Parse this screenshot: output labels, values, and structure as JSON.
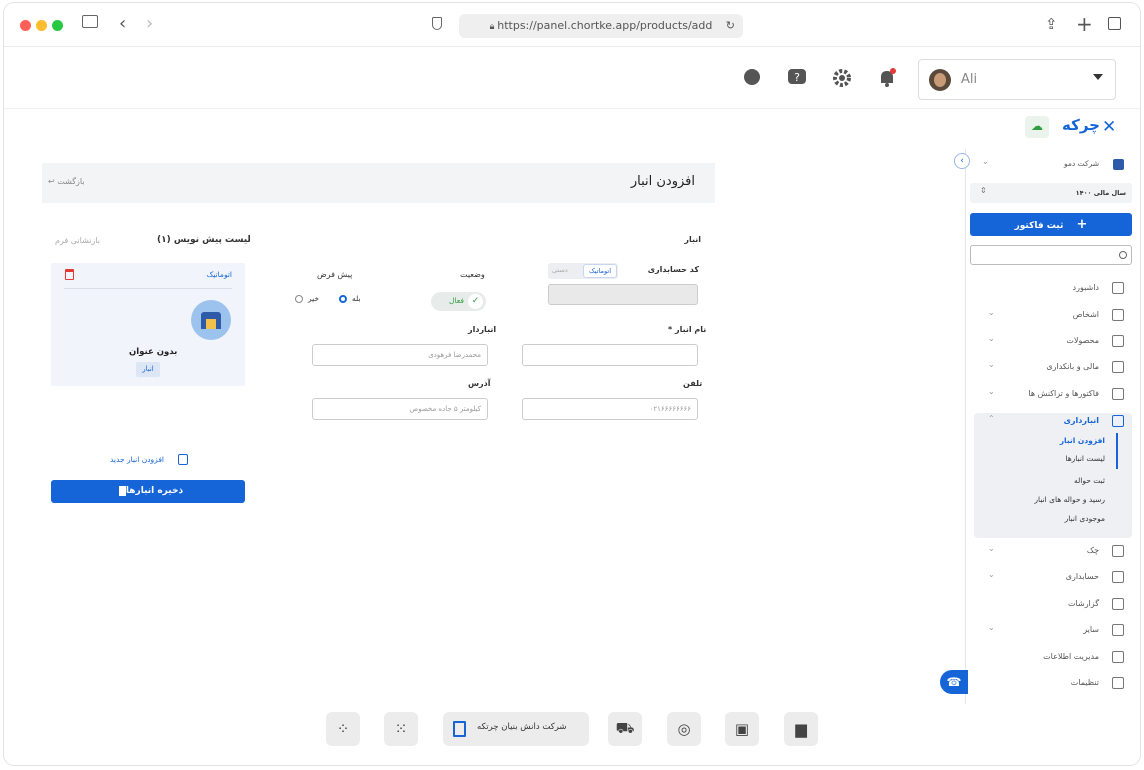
{
  "browser": {
    "url": "https://panel.chortke.app/products/add"
  },
  "header": {
    "user_name": "Ali"
  },
  "brand": {
    "name": "چرکه"
  },
  "sidebar": {
    "company": "شرکت دمو",
    "fiscal_year": "سال مالی ۱۴۰۰",
    "register_invoice": "ثبت فاکتور",
    "search_placeholder": "",
    "items": [
      {
        "label": "داشبورد",
        "icon": "dashboard-icon"
      },
      {
        "label": "اشخاص",
        "icon": "people-icon"
      },
      {
        "label": "محصولات",
        "icon": "box-icon"
      },
      {
        "label": "مالی و بانکداری",
        "icon": "bank-icon"
      },
      {
        "label": "فاکتورها و تراکنش ها",
        "icon": "transactions-icon"
      },
      {
        "label": "انبارداری",
        "icon": "warehouse-icon"
      },
      {
        "label": "چک",
        "icon": "check-icon"
      },
      {
        "label": "حسابداری",
        "icon": "accounting-icon"
      },
      {
        "label": "گزارشات",
        "icon": "reports-icon"
      },
      {
        "label": "سایر",
        "icon": "other-icon"
      },
      {
        "label": "مدیریت اطلاعات",
        "icon": "data-icon"
      },
      {
        "label": "تنظیمات",
        "icon": "settings-icon"
      }
    ],
    "warehouse_sub": [
      "افزودن انبار",
      "لیست انبارها",
      "ثبت حواله",
      "رسید و حواله های انبار",
      "موجودی انبار"
    ]
  },
  "page": {
    "title": "افزودن انبار",
    "back": "بازگشت",
    "section": "انبار",
    "accounting_code_label": "کد حسابداری",
    "code_auto": "اتوماتیک",
    "code_manual": "دستی",
    "status_label": "وضعیت",
    "status_value": "فعال",
    "default_label": "پیش فرض",
    "default_yes": "بله",
    "default_no": "خیر",
    "name_label": "نام انبار *",
    "keeper_label": "انباردار",
    "keeper_placeholder": "محمدرضا فرهودی",
    "phone_label": "تلفن",
    "phone_placeholder": "۰۲۱۶۶۶۶۶۶۶۶",
    "address_label": "آدرس",
    "address_placeholder": "کیلومتر ۵ جاده مخصوص"
  },
  "drafts": {
    "title": "لیست پیش نویس (۱)",
    "reset": "بازنشانی فرم",
    "card_auto": "اتوماتیک",
    "card_title": "بدون عنوان",
    "card_badge": "انبار",
    "add_new": "افزودن انبار جدید",
    "save": "ذخیره انبارها"
  },
  "dock": {
    "company": "شرکت دانش بنیان چرتکه"
  },
  "colors": {
    "primary": "#1565d8",
    "active_bg": "#eef0f3",
    "success": "#2e9e3e"
  }
}
